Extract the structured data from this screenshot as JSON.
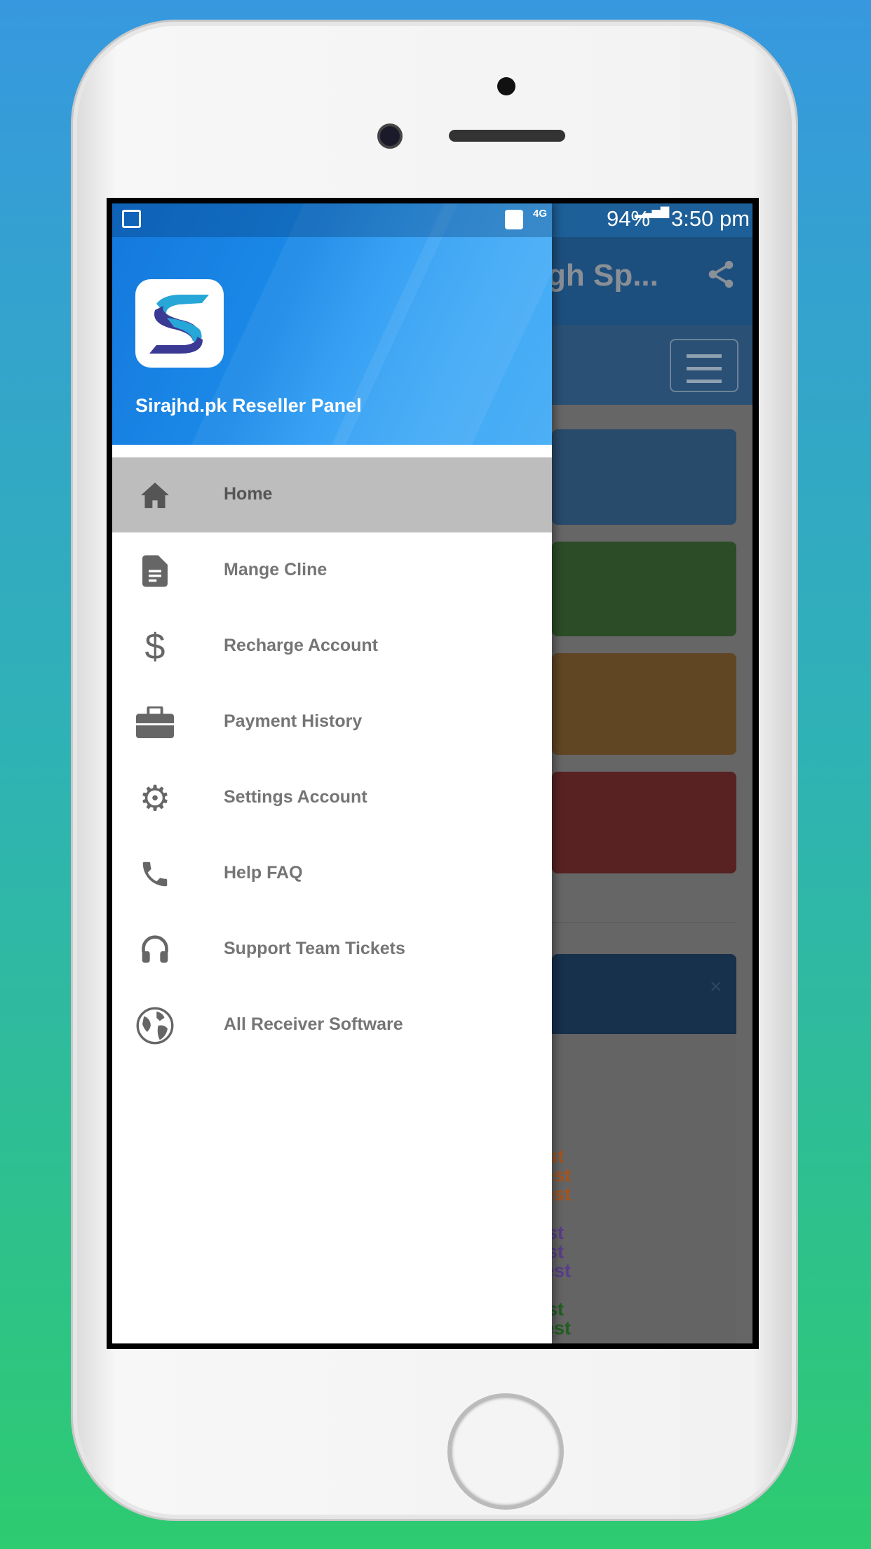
{
  "status_bar": {
    "battery": "94%",
    "time": "3:50 pm",
    "network": "4G"
  },
  "background_app": {
    "title_fragment": "gh Sp...",
    "card_colors": [
      "#284a6b",
      "#2c4c28",
      "#604623",
      "#582222"
    ],
    "text_fragments": [
      {
        "text": "st",
        "color": "#a5541d"
      },
      {
        "text": "est",
        "color": "#a5541d"
      },
      {
        "text": "est",
        "color": "#a5541d"
      },
      {
        "text": "st",
        "color": "#5a3d8a"
      },
      {
        "text": "st",
        "color": "#5a3d8a"
      },
      {
        "text": "est",
        "color": "#5a3d8a"
      },
      {
        "text": "st",
        "color": "#1f5f1f"
      },
      {
        "text": "est",
        "color": "#1f5f1f"
      }
    ],
    "close_symbol": "×"
  },
  "drawer": {
    "title": "Sirajhd.pk Reseller Panel",
    "items": [
      {
        "label": "Home",
        "icon": "home-icon",
        "active": true
      },
      {
        "label": "Mange Cline",
        "icon": "document-icon"
      },
      {
        "label": "Recharge Account",
        "icon": "dollar-icon"
      },
      {
        "label": "Payment History",
        "icon": "briefcase-icon"
      },
      {
        "label": "Settings Account",
        "icon": "gear-icon"
      },
      {
        "label": "Help FAQ",
        "icon": "phone-icon"
      },
      {
        "label": "Support Team Tickets",
        "icon": "headset-icon"
      },
      {
        "label": "All Receiver Software",
        "icon": "globe-icon"
      }
    ]
  }
}
